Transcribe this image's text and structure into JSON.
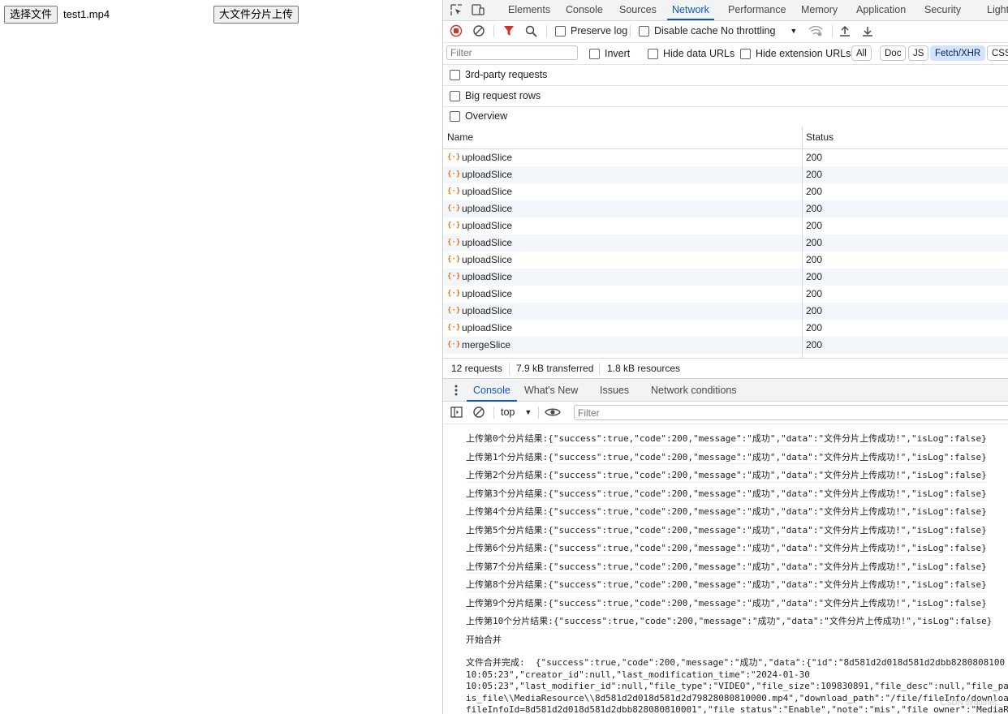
{
  "page": {
    "choose_file_label": "选择文件",
    "file_name": "test1.mp4",
    "upload_button_label": "大文件分片上传"
  },
  "devtools": {
    "tabs": [
      "Elements",
      "Console",
      "Sources",
      "Network",
      "Performance",
      "Memory",
      "Application",
      "Security",
      "Light"
    ],
    "active_tab": "Network",
    "toolbar": {
      "preserve_log": "Preserve log",
      "disable_cache": "Disable cache",
      "throttling": "No throttling"
    },
    "filter": {
      "placeholder": "Filter",
      "invert": "Invert",
      "hide_data_urls": "Hide data URLs",
      "hide_extension_urls": "Hide extension URLs",
      "types": [
        "All",
        "Doc",
        "JS",
        "Fetch/XHR",
        "CSS"
      ],
      "selected_type": "Fetch/XHR"
    },
    "options": {
      "third_party": "3rd-party requests",
      "big_rows": "Big request rows",
      "overview": "Overview"
    },
    "table": {
      "col_name": "Name",
      "col_status": "Status",
      "rows": [
        {
          "name": "uploadSlice",
          "status": "200"
        },
        {
          "name": "uploadSlice",
          "status": "200"
        },
        {
          "name": "uploadSlice",
          "status": "200"
        },
        {
          "name": "uploadSlice",
          "status": "200"
        },
        {
          "name": "uploadSlice",
          "status": "200"
        },
        {
          "name": "uploadSlice",
          "status": "200"
        },
        {
          "name": "uploadSlice",
          "status": "200"
        },
        {
          "name": "uploadSlice",
          "status": "200"
        },
        {
          "name": "uploadSlice",
          "status": "200"
        },
        {
          "name": "uploadSlice",
          "status": "200"
        },
        {
          "name": "uploadSlice",
          "status": "200"
        },
        {
          "name": "mergeSlice",
          "status": "200"
        }
      ]
    },
    "summary": {
      "requests": "12 requests",
      "transferred": "7.9 kB transferred",
      "resources": "1.8 kB resources"
    },
    "drawer_tabs": [
      "Console",
      "What's New",
      "Issues",
      "Network conditions"
    ],
    "drawer_active": "Console",
    "console_toolbar": {
      "context": "top",
      "filter_placeholder": "Filter"
    },
    "console_lines": [
      "上传第0个分片结果:{\"success\":true,\"code\":200,\"message\":\"成功\",\"data\":\"文件分片上传成功!\",\"isLog\":false}",
      "上传第1个分片结果:{\"success\":true,\"code\":200,\"message\":\"成功\",\"data\":\"文件分片上传成功!\",\"isLog\":false}",
      "上传第2个分片结果:{\"success\":true,\"code\":200,\"message\":\"成功\",\"data\":\"文件分片上传成功!\",\"isLog\":false}",
      "上传第3个分片结果:{\"success\":true,\"code\":200,\"message\":\"成功\",\"data\":\"文件分片上传成功!\",\"isLog\":false}",
      "上传第4个分片结果:{\"success\":true,\"code\":200,\"message\":\"成功\",\"data\":\"文件分片上传成功!\",\"isLog\":false}",
      "上传第5个分片结果:{\"success\":true,\"code\":200,\"message\":\"成功\",\"data\":\"文件分片上传成功!\",\"isLog\":false}",
      "上传第6个分片结果:{\"success\":true,\"code\":200,\"message\":\"成功\",\"data\":\"文件分片上传成功!\",\"isLog\":false}",
      "上传第7个分片结果:{\"success\":true,\"code\":200,\"message\":\"成功\",\"data\":\"文件分片上传成功!\",\"isLog\":false}",
      "上传第8个分片结果:{\"success\":true,\"code\":200,\"message\":\"成功\",\"data\":\"文件分片上传成功!\",\"isLog\":false}",
      "上传第9个分片结果:{\"success\":true,\"code\":200,\"message\":\"成功\",\"data\":\"文件分片上传成功!\",\"isLog\":false}",
      "上传第10个分片结果:{\"success\":true,\"code\":200,\"message\":\"成功\",\"data\":\"文件分片上传成功!\",\"isLog\":false}",
      "开始合并"
    ],
    "console_final": [
      "文件合并完成:  {\"success\":true,\"code\":200,\"message\":\"成功\",\"data\":{\"id\":\"8d581d2d018d581d2dbb8280808100",
      "10:05:23\",\"creator_id\":null,\"last_modification_time\":\"2024-01-30",
      "10:05:23\",\"last_modifier_id\":null,\"file_type\":\"VIDEO\",\"file_size\":109830891,\"file_desc\":null,\"file_pat",
      "is_file\\\\MediaResource\\\\8d581d2d018d581d2d79828080810000.mp4\",\"download_path\":\"/file/fileInfo/downloa",
      "fileInfoId=8d581d2d018d581d2dbb828080810001\",\"file_status\":\"Enable\",\"note\":\"mis\",\"file_owner\":\"MediaRe"
    ],
    "watermark": "CSDN @dotnet..."
  }
}
